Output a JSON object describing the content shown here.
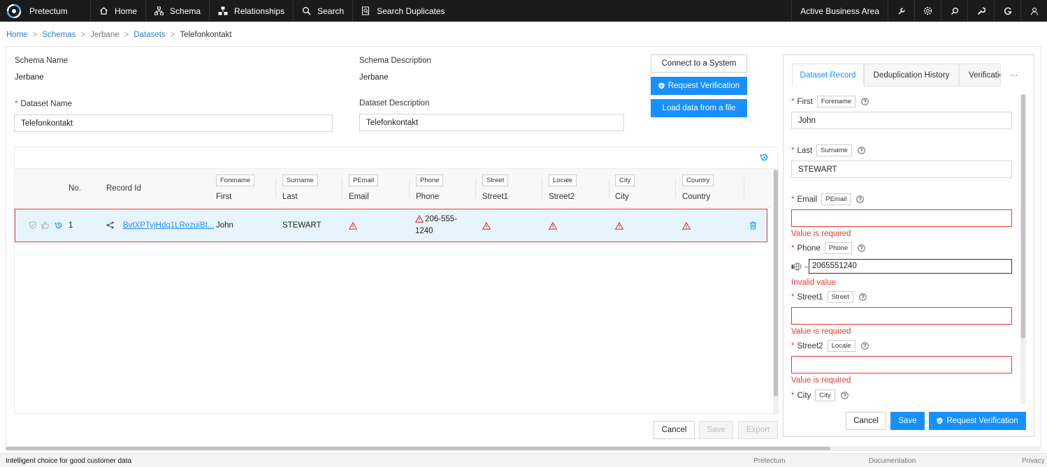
{
  "app": {
    "name": "Pretectum"
  },
  "nav": [
    {
      "label": "Home",
      "icon": "home-icon"
    },
    {
      "label": "Schema",
      "icon": "schema-icon"
    },
    {
      "label": "Relationships",
      "icon": "relationships-icon"
    },
    {
      "label": "Search",
      "icon": "search-icon"
    },
    {
      "label": "Search Duplicates",
      "icon": "search-duplicates-icon"
    }
  ],
  "topright": {
    "business_area": "Active Business Area"
  },
  "breadcrumb": {
    "home": "Home",
    "schemas": "Schemas",
    "schema": "Jerbane",
    "datasets": "Datasets",
    "current": "Telefonkontakt",
    "sep": ">"
  },
  "form": {
    "schema_name_label": "Schema Name",
    "schema_name": "Jerbane",
    "schema_desc_label": "Schema Description",
    "schema_desc": "Jerbane",
    "dataset_name_label": "Dataset Name",
    "dataset_name": "Telefonkontakt",
    "dataset_desc_label": "Dataset Description",
    "dataset_desc": "Telefonkontakt",
    "required_mark": "*"
  },
  "actions": {
    "connect": "Connect to a System",
    "request_verification": "Request Verification",
    "load_data": "Load data from a file",
    "cancel": "Cancel",
    "save": "Save",
    "export": "Export"
  },
  "grid": {
    "col_no": "No.",
    "col_record_id": "Record Id",
    "columns": [
      {
        "tag": "Forename",
        "label": "First"
      },
      {
        "tag": "Surname",
        "label": "Last"
      },
      {
        "tag": "PEmail",
        "label": "Email"
      },
      {
        "tag": "Phone",
        "label": "Phone"
      },
      {
        "tag": "Street",
        "label": "Street1"
      },
      {
        "tag": "Locale",
        "label": "Street2"
      },
      {
        "tag": "City",
        "label": "City"
      },
      {
        "tag": "Country",
        "label": "Country"
      }
    ],
    "rows": [
      {
        "no": "1",
        "record_id": "BvtXPTyjHdq1LRezuiBt...",
        "first": "John",
        "last": "STEWART",
        "phone_line1": "206-555-",
        "phone_line2": "1240"
      }
    ]
  },
  "right_panel": {
    "tabs": [
      "Dataset Record",
      "Deduplication History",
      "Verification"
    ],
    "more": "···",
    "fields": [
      {
        "label": "First",
        "tag": "Forename",
        "value": "John",
        "error": ""
      },
      {
        "label": "Last",
        "tag": "Surname",
        "value": "STEWART",
        "error": ""
      },
      {
        "label": "Email",
        "tag": "PEmail",
        "value": "",
        "error": "Value is required"
      },
      {
        "label": "Phone",
        "tag": "Phone",
        "value": "2065551240",
        "error": "Invalid value"
      },
      {
        "label": "Street1",
        "tag": "Street",
        "value": "",
        "error": "Value is required"
      },
      {
        "label": "Street2",
        "tag": "Locale",
        "value": "",
        "error": "Value is required"
      },
      {
        "label": "City",
        "tag": "City",
        "value": "",
        "error": ""
      }
    ],
    "cancel": "Cancel",
    "save": "Save",
    "request_verification": "Request Verification"
  },
  "footer": {
    "tagline": "Intelligent choice for good customer data",
    "link1": "Pretectum",
    "link2": "Documentation",
    "link3": "Privacy"
  },
  "colors": {
    "primary": "#1890ff",
    "error": "#e53935",
    "topbar": "#1b1b1b",
    "row_selected": "#e8f4fd"
  }
}
